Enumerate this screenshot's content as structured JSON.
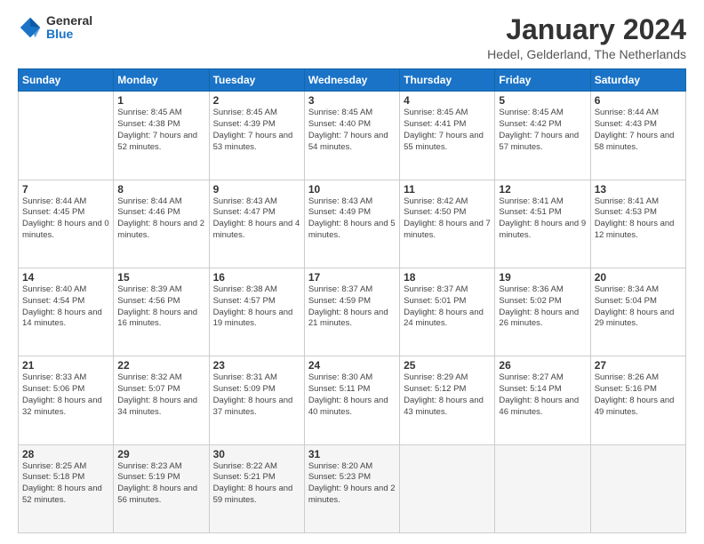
{
  "logo": {
    "general": "General",
    "blue": "Blue"
  },
  "title": "January 2024",
  "subtitle": "Hedel, Gelderland, The Netherlands",
  "days_header": [
    "Sunday",
    "Monday",
    "Tuesday",
    "Wednesday",
    "Thursday",
    "Friday",
    "Saturday"
  ],
  "weeks": [
    [
      {
        "day": "",
        "sunrise": "",
        "sunset": "",
        "daylight": ""
      },
      {
        "day": "1",
        "sunrise": "Sunrise: 8:45 AM",
        "sunset": "Sunset: 4:38 PM",
        "daylight": "Daylight: 7 hours and 52 minutes."
      },
      {
        "day": "2",
        "sunrise": "Sunrise: 8:45 AM",
        "sunset": "Sunset: 4:39 PM",
        "daylight": "Daylight: 7 hours and 53 minutes."
      },
      {
        "day": "3",
        "sunrise": "Sunrise: 8:45 AM",
        "sunset": "Sunset: 4:40 PM",
        "daylight": "Daylight: 7 hours and 54 minutes."
      },
      {
        "day": "4",
        "sunrise": "Sunrise: 8:45 AM",
        "sunset": "Sunset: 4:41 PM",
        "daylight": "Daylight: 7 hours and 55 minutes."
      },
      {
        "day": "5",
        "sunrise": "Sunrise: 8:45 AM",
        "sunset": "Sunset: 4:42 PM",
        "daylight": "Daylight: 7 hours and 57 minutes."
      },
      {
        "day": "6",
        "sunrise": "Sunrise: 8:44 AM",
        "sunset": "Sunset: 4:43 PM",
        "daylight": "Daylight: 7 hours and 58 minutes."
      }
    ],
    [
      {
        "day": "7",
        "sunrise": "Sunrise: 8:44 AM",
        "sunset": "Sunset: 4:45 PM",
        "daylight": "Daylight: 8 hours and 0 minutes."
      },
      {
        "day": "8",
        "sunrise": "Sunrise: 8:44 AM",
        "sunset": "Sunset: 4:46 PM",
        "daylight": "Daylight: 8 hours and 2 minutes."
      },
      {
        "day": "9",
        "sunrise": "Sunrise: 8:43 AM",
        "sunset": "Sunset: 4:47 PM",
        "daylight": "Daylight: 8 hours and 4 minutes."
      },
      {
        "day": "10",
        "sunrise": "Sunrise: 8:43 AM",
        "sunset": "Sunset: 4:49 PM",
        "daylight": "Daylight: 8 hours and 5 minutes."
      },
      {
        "day": "11",
        "sunrise": "Sunrise: 8:42 AM",
        "sunset": "Sunset: 4:50 PM",
        "daylight": "Daylight: 8 hours and 7 minutes."
      },
      {
        "day": "12",
        "sunrise": "Sunrise: 8:41 AM",
        "sunset": "Sunset: 4:51 PM",
        "daylight": "Daylight: 8 hours and 9 minutes."
      },
      {
        "day": "13",
        "sunrise": "Sunrise: 8:41 AM",
        "sunset": "Sunset: 4:53 PM",
        "daylight": "Daylight: 8 hours and 12 minutes."
      }
    ],
    [
      {
        "day": "14",
        "sunrise": "Sunrise: 8:40 AM",
        "sunset": "Sunset: 4:54 PM",
        "daylight": "Daylight: 8 hours and 14 minutes."
      },
      {
        "day": "15",
        "sunrise": "Sunrise: 8:39 AM",
        "sunset": "Sunset: 4:56 PM",
        "daylight": "Daylight: 8 hours and 16 minutes."
      },
      {
        "day": "16",
        "sunrise": "Sunrise: 8:38 AM",
        "sunset": "Sunset: 4:57 PM",
        "daylight": "Daylight: 8 hours and 19 minutes."
      },
      {
        "day": "17",
        "sunrise": "Sunrise: 8:37 AM",
        "sunset": "Sunset: 4:59 PM",
        "daylight": "Daylight: 8 hours and 21 minutes."
      },
      {
        "day": "18",
        "sunrise": "Sunrise: 8:37 AM",
        "sunset": "Sunset: 5:01 PM",
        "daylight": "Daylight: 8 hours and 24 minutes."
      },
      {
        "day": "19",
        "sunrise": "Sunrise: 8:36 AM",
        "sunset": "Sunset: 5:02 PM",
        "daylight": "Daylight: 8 hours and 26 minutes."
      },
      {
        "day": "20",
        "sunrise": "Sunrise: 8:34 AM",
        "sunset": "Sunset: 5:04 PM",
        "daylight": "Daylight: 8 hours and 29 minutes."
      }
    ],
    [
      {
        "day": "21",
        "sunrise": "Sunrise: 8:33 AM",
        "sunset": "Sunset: 5:06 PM",
        "daylight": "Daylight: 8 hours and 32 minutes."
      },
      {
        "day": "22",
        "sunrise": "Sunrise: 8:32 AM",
        "sunset": "Sunset: 5:07 PM",
        "daylight": "Daylight: 8 hours and 34 minutes."
      },
      {
        "day": "23",
        "sunrise": "Sunrise: 8:31 AM",
        "sunset": "Sunset: 5:09 PM",
        "daylight": "Daylight: 8 hours and 37 minutes."
      },
      {
        "day": "24",
        "sunrise": "Sunrise: 8:30 AM",
        "sunset": "Sunset: 5:11 PM",
        "daylight": "Daylight: 8 hours and 40 minutes."
      },
      {
        "day": "25",
        "sunrise": "Sunrise: 8:29 AM",
        "sunset": "Sunset: 5:12 PM",
        "daylight": "Daylight: 8 hours and 43 minutes."
      },
      {
        "day": "26",
        "sunrise": "Sunrise: 8:27 AM",
        "sunset": "Sunset: 5:14 PM",
        "daylight": "Daylight: 8 hours and 46 minutes."
      },
      {
        "day": "27",
        "sunrise": "Sunrise: 8:26 AM",
        "sunset": "Sunset: 5:16 PM",
        "daylight": "Daylight: 8 hours and 49 minutes."
      }
    ],
    [
      {
        "day": "28",
        "sunrise": "Sunrise: 8:25 AM",
        "sunset": "Sunset: 5:18 PM",
        "daylight": "Daylight: 8 hours and 52 minutes."
      },
      {
        "day": "29",
        "sunrise": "Sunrise: 8:23 AM",
        "sunset": "Sunset: 5:19 PM",
        "daylight": "Daylight: 8 hours and 56 minutes."
      },
      {
        "day": "30",
        "sunrise": "Sunrise: 8:22 AM",
        "sunset": "Sunset: 5:21 PM",
        "daylight": "Daylight: 8 hours and 59 minutes."
      },
      {
        "day": "31",
        "sunrise": "Sunrise: 8:20 AM",
        "sunset": "Sunset: 5:23 PM",
        "daylight": "Daylight: 9 hours and 2 minutes."
      },
      {
        "day": "",
        "sunrise": "",
        "sunset": "",
        "daylight": ""
      },
      {
        "day": "",
        "sunrise": "",
        "sunset": "",
        "daylight": ""
      },
      {
        "day": "",
        "sunrise": "",
        "sunset": "",
        "daylight": ""
      }
    ]
  ]
}
